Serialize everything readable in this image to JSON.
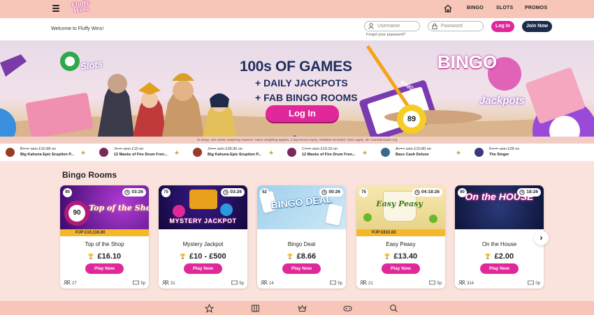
{
  "header": {
    "logo_text": "Fluffy Wins",
    "nav": [
      "BINGO",
      "SLOTS",
      "PROMOS"
    ],
    "icons": {
      "menu": "hamburger-icon",
      "home": "home-icon"
    }
  },
  "welcome": {
    "message": "Welcome to Fluffy Wins!",
    "username_placeholder": "Username",
    "password_placeholder": "Password",
    "forgot": "Forgot your password?",
    "login": "Log In",
    "join": "Join Now"
  },
  "hero": {
    "sign_slots": "Slots",
    "sign_bingo": "BINGO",
    "sign_jackpots": "Jackpots",
    "headline": "100s OF GAMES",
    "line1": "+  DAILY JACKPOTS",
    "line2": "+  FAB BINGO ROOMS",
    "cta": "Log In",
    "card_label": "BINGO",
    "ball_number": "89"
  },
  "disclaimer": "3x bingo, 10x casino wagering required. Game weighting applies. 2 day bonus expiry. eWallets excluded. T&Cs apply. 18+ GambleAware.org",
  "winners": [
    {
      "who": "B••••• won £10.88 on",
      "game": "Big Kahuna Epic Eruption P...",
      "color": "#9a3a2a"
    },
    {
      "who": "J••••• won £10 on",
      "game": "12 Masks of Fire Drum Fren...",
      "color": "#7a2a5a"
    },
    {
      "who": "J••••• won £39.90 on",
      "game": "Big Kahuna Epic Eruption P...",
      "color": "#9a3a2a"
    },
    {
      "who": "C••••• won £10.20 on",
      "game": "12 Masks of Fire Drum Fren...",
      "color": "#7a2a5a"
    },
    {
      "who": "A••••• won £10.80 on",
      "game": "Bass Cash Deluxe",
      "color": "#3a6a8a"
    },
    {
      "who": "K••••• won £28 on",
      "game": "The Singer",
      "color": "#3a3a7a"
    }
  ],
  "section_title": "Bingo Rooms",
  "rooms": [
    {
      "ball": "90",
      "timer": "03:26",
      "art": "Top of the Shop",
      "pjp": "PJP  £10,116.80",
      "name": "Top of the Shop",
      "prize": "£16.10",
      "play": "Play Now",
      "players": "27",
      "cost": "5p"
    },
    {
      "ball": "75",
      "timer": "03:26",
      "art": "MYSTERY JACKPOT",
      "pjp": "",
      "name": "Mystery Jackpot",
      "prize": "£10 - £500",
      "play": "Play Now",
      "players": "31",
      "cost": "5p"
    },
    {
      "ball": "52",
      "timer": "00:26",
      "art": "BINGO DEAL",
      "pjp": "",
      "name": "Bingo Deal",
      "prize": "£8.66",
      "play": "Play Now",
      "players": "14",
      "cost": "5p"
    },
    {
      "ball": "75",
      "timer": "04:18:26",
      "art": "Easy Peasy",
      "pjp": "PJP  £810.83",
      "name": "Easy Peasy",
      "prize": "£13.40",
      "play": "Play Now",
      "players": "21",
      "cost": "5p"
    },
    {
      "ball": "90",
      "timer": "18:26",
      "art": "On the HOUSE",
      "pjp": "",
      "name": "On the House",
      "prize": "£2.00",
      "play": "Play Now",
      "players": "314",
      "cost": "0p"
    }
  ],
  "bottom_nav": [
    "star-icon",
    "slots-icon",
    "crown-icon",
    "gamepad-icon",
    "search-icon"
  ],
  "colors": {
    "accent": "#e0289a",
    "navy": "#1d2a4c",
    "nav_bg": "#f8c6b9",
    "page_bg": "#fbe3dd",
    "jackpot": "#f5b829"
  }
}
